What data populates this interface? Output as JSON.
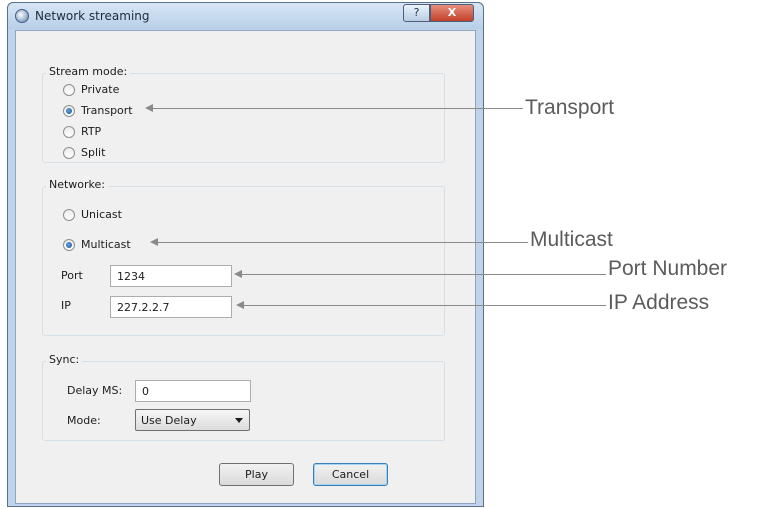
{
  "window": {
    "title": "Network streaming",
    "help_label": "?",
    "close_label": "X"
  },
  "stream_mode": {
    "label": "Stream mode:",
    "options": [
      {
        "label": "Private",
        "selected": false
      },
      {
        "label": "Transport",
        "selected": true
      },
      {
        "label": "RTP",
        "selected": false
      },
      {
        "label": "Split",
        "selected": false
      }
    ]
  },
  "network": {
    "label": "Networke:",
    "options": [
      {
        "label": "Unicast",
        "selected": false
      },
      {
        "label": "Multicast",
        "selected": true
      }
    ],
    "port_label": "Port",
    "port_value": "1234",
    "ip_label": "IP",
    "ip_value": "227.2.2.7"
  },
  "sync": {
    "label": "Sync:",
    "delay_label": "Delay MS:",
    "delay_value": "0",
    "mode_label": "Mode:",
    "mode_value": "Use Delay"
  },
  "buttons": {
    "play": "Play",
    "cancel": "Cancel"
  },
  "annotations": {
    "transport": "Transport",
    "multicast": "Multicast",
    "port_number": "Port Number",
    "ip_address": "IP Address"
  },
  "colors": {
    "radio_selected": "#1a4f93",
    "close_button": "#c2402a",
    "annotation_text": "#5b5b5b"
  }
}
